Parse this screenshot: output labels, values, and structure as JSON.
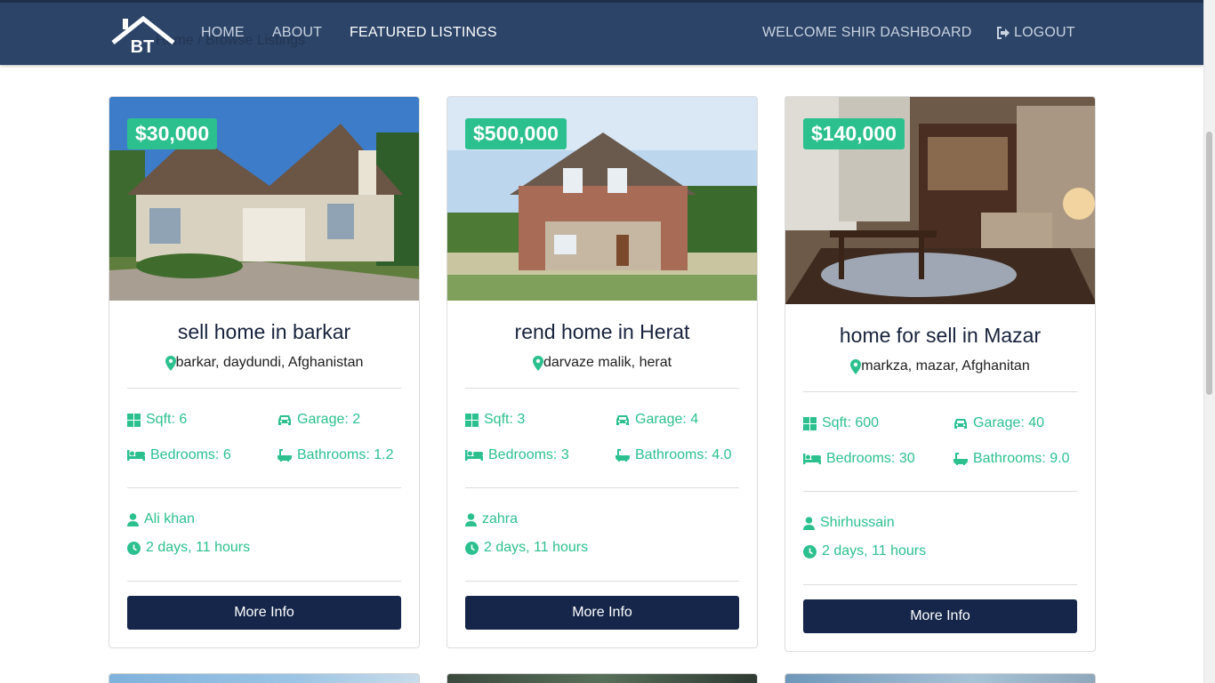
{
  "navbar": {
    "logo_text": "BT",
    "breadcrumb_ghost": "Home  /  Browse Listings",
    "links": [
      {
        "label": "HOME"
      },
      {
        "label": "ABOUT"
      },
      {
        "label": "FEATURED LISTINGS"
      }
    ],
    "welcome": "WELCOME SHIR DASHBOARD",
    "logout": "LOGOUT"
  },
  "listings": [
    {
      "price": "$30,000",
      "title": "sell home in barkar",
      "location": "barkar, daydundi, Afghanistan",
      "sqft": "Sqft: 6",
      "garage": "Garage: 2",
      "bedrooms": "Bedrooms: 6",
      "bathrooms": "Bathrooms: 1.2",
      "realtor": "Ali khan",
      "listed": "2 days, 11 hours",
      "button": "More Info"
    },
    {
      "price": "$500,000",
      "title": "rend home in Herat",
      "location": "darvaze malik, herat",
      "sqft": "Sqft: 3",
      "garage": "Garage: 4",
      "bedrooms": "Bedrooms: 3",
      "bathrooms": "Bathrooms: 4.0",
      "realtor": "zahra",
      "listed": "2 days, 11 hours",
      "button": "More Info"
    },
    {
      "price": "$140,000",
      "title": "home for sell in Mazar",
      "location": "markza, mazar, Afghanitan",
      "sqft": "Sqft: 600",
      "garage": "Garage: 40",
      "bedrooms": "Bedrooms: 30",
      "bathrooms": "Bathrooms: 9.0",
      "realtor": "Shirhussain",
      "listed": "2 days, 11 hours",
      "button": "More Info"
    }
  ],
  "colors": {
    "navbar": "#2c4468",
    "accent": "#2cc08f",
    "button": "#15264a",
    "title": "#17233d"
  },
  "icons": [
    "logo-house-icon",
    "logout-icon",
    "map-marker-icon",
    "grid-icon",
    "car-icon",
    "bed-icon",
    "bath-icon",
    "user-icon",
    "clock-icon"
  ]
}
